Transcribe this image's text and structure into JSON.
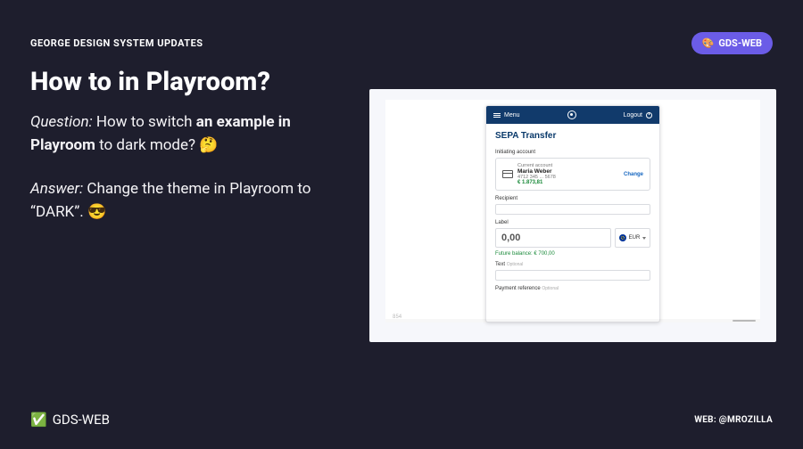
{
  "overline": "GEORGE DESIGN SYSTEM UPDATES",
  "pill": {
    "emoji": "🎨",
    "label": "GDS-WEB"
  },
  "title": "How to in Playroom?",
  "question": {
    "label": "Question:",
    "pre": "How to switch",
    "bold": "an example in Playroom",
    "post": "to dark mode?",
    "emoji": "🤔"
  },
  "answer": {
    "label": "Answer:",
    "text": "Change the theme in Playroom to “DARK”.",
    "emoji": "😎"
  },
  "mobile": {
    "menu": "Menu",
    "logout": "Logout",
    "title": "SEPA Transfer",
    "initiating_label": "Initiating account",
    "account_type": "Current account",
    "account_name": "Maria Weber",
    "account_masked": "4712 345 ... 5678",
    "account_balance": "€ 1.873,81",
    "change": "Change",
    "recipient_label": "Recipient",
    "label_label": "Label",
    "amount": "0,00",
    "currency": "EUR",
    "future_balance": "Future balance: € 700,00",
    "text_label": "Text",
    "optional": "Optional",
    "payment_ref": "Payment reference",
    "preview_meta_px": "854"
  },
  "footer": {
    "emoji": "✅",
    "left": "GDS-WEB",
    "right": "WEB: @MROZILLA"
  }
}
